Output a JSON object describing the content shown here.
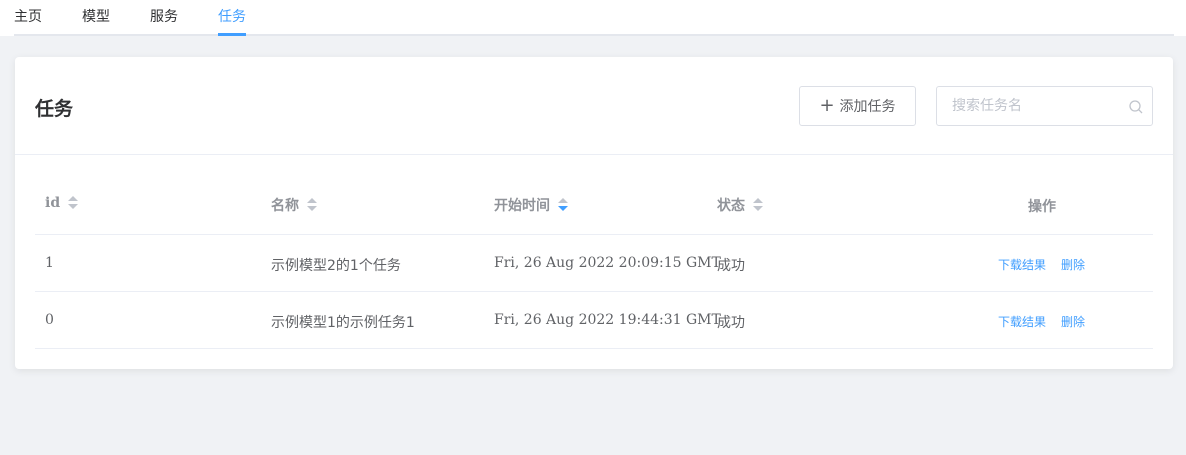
{
  "nav": {
    "tabs": [
      {
        "label": "主页"
      },
      {
        "label": "模型"
      },
      {
        "label": "服务"
      },
      {
        "label": "任务"
      }
    ],
    "active_index": 3
  },
  "card": {
    "title": "任务",
    "add_button_label": "添加任务",
    "search": {
      "placeholder": "搜索任务名",
      "value": ""
    }
  },
  "table": {
    "columns": [
      {
        "label": "id",
        "sortable": true,
        "sort": "none"
      },
      {
        "label": "名称",
        "sortable": true,
        "sort": "none"
      },
      {
        "label": "开始时间",
        "sortable": true,
        "sort": "descending"
      },
      {
        "label": "状态",
        "sortable": true,
        "sort": "none"
      },
      {
        "label": "操作",
        "sortable": false
      }
    ],
    "rows": [
      {
        "id": "1",
        "name": "示例模型2的1个任务",
        "start_time": "Fri, 26 Aug 2022 20:09:15 GMT",
        "status": "成功",
        "actions": [
          "下载结果",
          "删除"
        ]
      },
      {
        "id": "0",
        "name": "示例模型1的示例任务1",
        "start_time": "Fri, 26 Aug 2022 19:44:31 GMT",
        "status": "成功",
        "actions": [
          "下载结果",
          "删除"
        ]
      }
    ]
  },
  "colors": {
    "accent": "#409eff",
    "background": "#f0f2f5",
    "border": "#ebeef5"
  }
}
